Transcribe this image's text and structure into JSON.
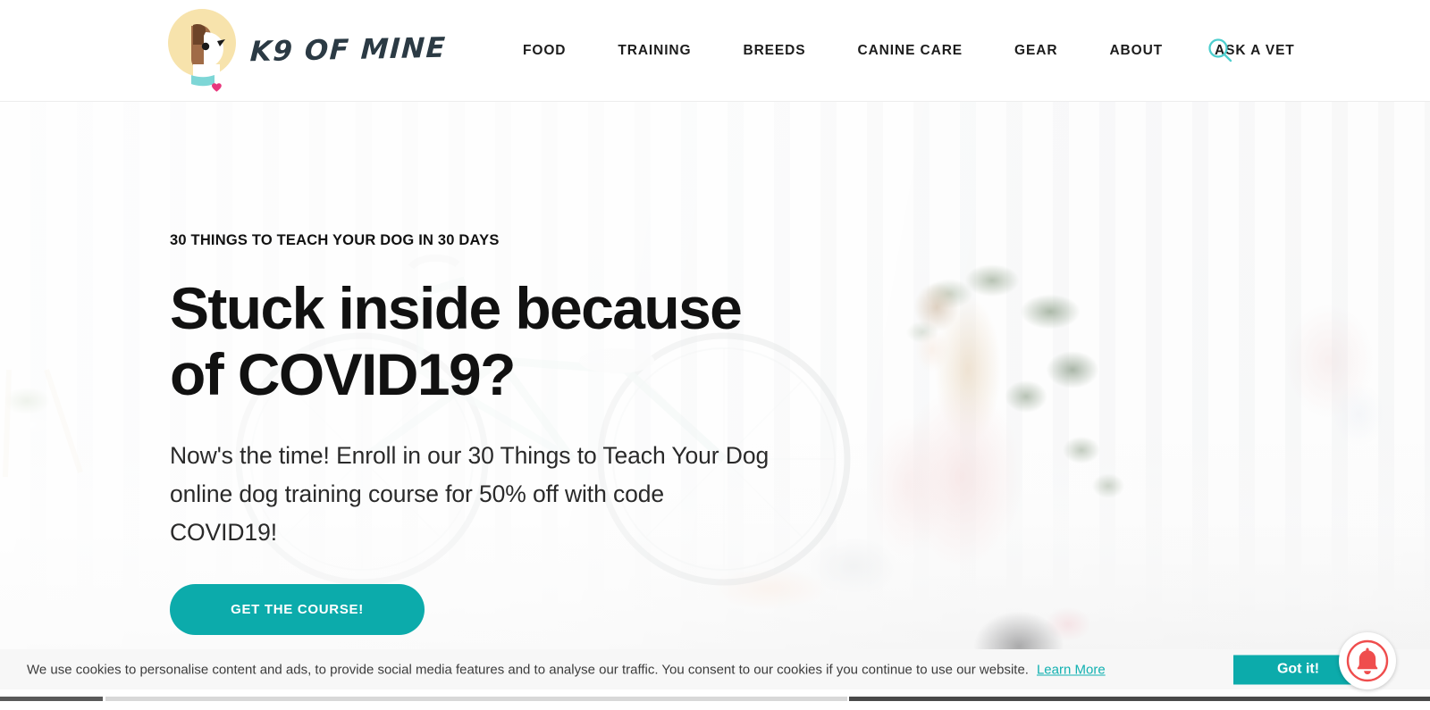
{
  "site": {
    "brand_name": "K9 OF MINE",
    "logo_icon": "dog-head-logo-icon"
  },
  "header": {
    "nav_items": [
      {
        "label": "FOOD",
        "name": "nav-item-food"
      },
      {
        "label": "TRAINING",
        "name": "nav-item-training"
      },
      {
        "label": "BREEDS",
        "name": "nav-item-breeds"
      },
      {
        "label": "CANINE CARE",
        "name": "nav-item-canine-care"
      },
      {
        "label": "GEAR",
        "name": "nav-item-gear"
      },
      {
        "label": "ABOUT",
        "name": "nav-item-about"
      },
      {
        "label": "ASK A VET",
        "name": "nav-item-ask-a-vet"
      }
    ],
    "search_icon": "search-icon"
  },
  "hero": {
    "eyebrow": "30 THINGS TO TEACH YOUR DOG IN 30 DAYS",
    "headline": "Stuck inside because of COVID19?",
    "subhead": "Now's the time! Enroll in our 30 Things to Teach Your Dog online dog training course for 50% off with code COVID19!",
    "cta_label": "GET THE COURSE!"
  },
  "cookie_banner": {
    "message": "We use cookies to personalise content and ads, to provide social media features and to analyse our traffic. You consent to our cookies if you continue to use our website.",
    "learn_more_label": "Learn More",
    "accept_label": "Got it!"
  },
  "notification": {
    "icon": "bell-icon"
  },
  "colors": {
    "teal_accent": "#0cabab",
    "teal_light": "#4dcece",
    "logo_cream": "#f7e3ac",
    "logo_brown": "#a06b46",
    "logo_collar": "#7dd6d6",
    "logo_heart": "#e8377d",
    "wordmark": "#2b3a44",
    "bell_red": "#ef4d4d",
    "cookie_bg": "#f7f7f7",
    "text_dark": "#111111"
  }
}
